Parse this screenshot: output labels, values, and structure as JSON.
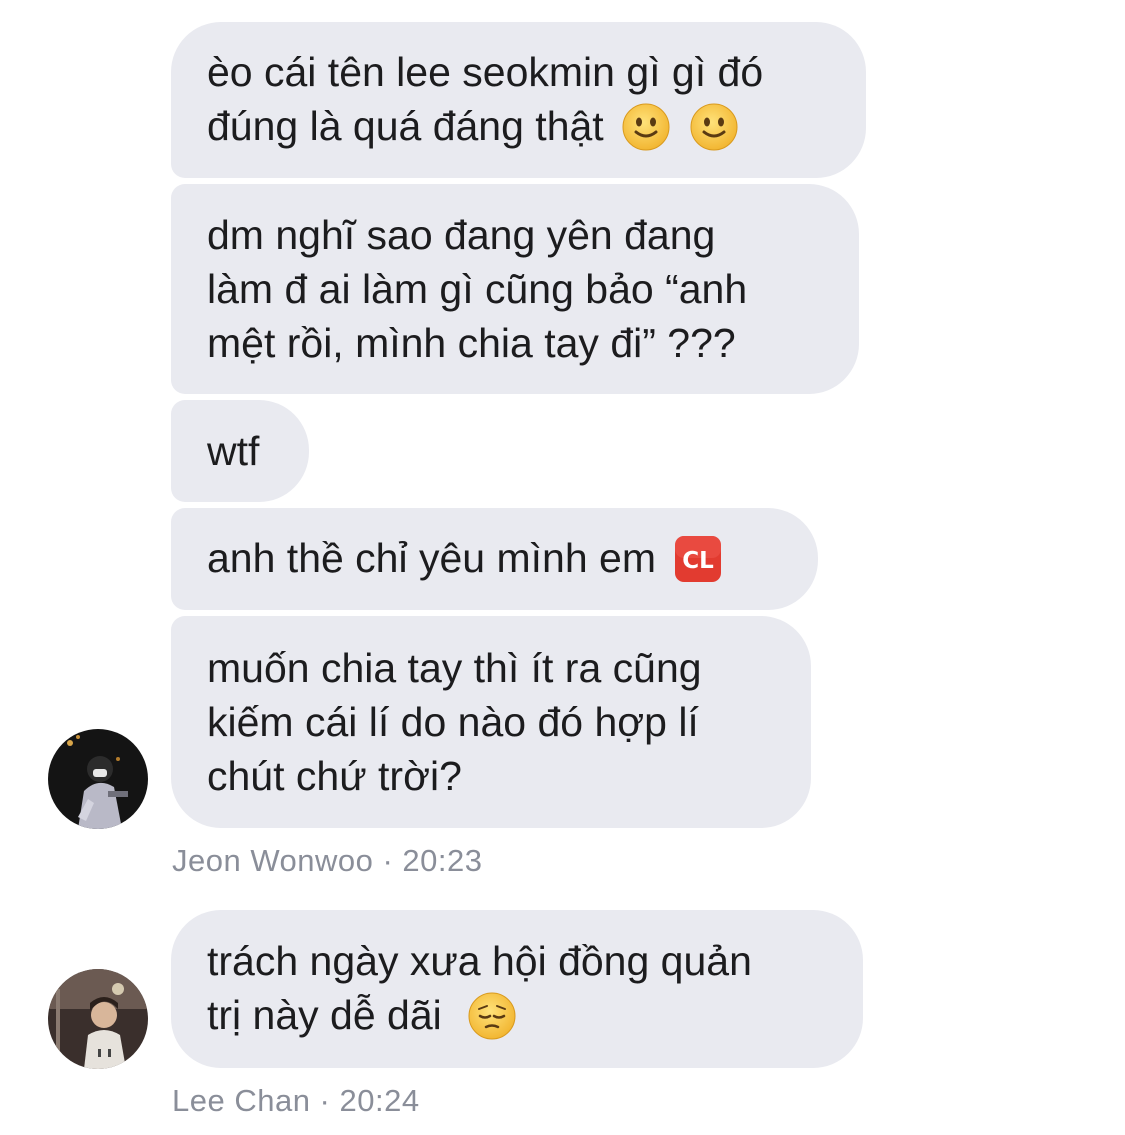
{
  "messages": [
    {
      "lines": [
        "èo cái tên lee seokmin gì gì đó",
        "đúng là quá đáng thật"
      ],
      "emoji": [
        "slightly-smiling-face",
        "slightly-smiling-face"
      ]
    },
    {
      "lines": [
        "dm nghĩ sao đang yên đang",
        "làm đ ai làm gì cũng bảo “anh",
        "mệt rồi, mình chia tay đi” ???"
      ]
    },
    {
      "lines": [
        "wtf"
      ]
    },
    {
      "lines": [
        "anh thề chỉ yêu mình em"
      ],
      "emoji": [
        "cl-button"
      ]
    },
    {
      "lines": [
        "muốn chia tay thì ít ra cũng",
        "kiếm cái lí do nào đó hợp lí",
        "chút chứ trời?"
      ]
    },
    {
      "lines": [
        "trách ngày xưa hội đồng quản",
        "trị này dễ dãi"
      ],
      "emoji": [
        "pensive-face"
      ]
    }
  ],
  "groups": [
    {
      "sender": "Jeon Wonwoo",
      "time": "20:23",
      "meta": "Jeon Wonwoo · 20:23",
      "avatar": "avatar-jeon-wonwoo"
    },
    {
      "sender": "Lee Chan",
      "time": "20:24",
      "meta": "Lee Chan · 20:24",
      "avatar": "avatar-lee-chan"
    }
  ],
  "colors": {
    "bubble": "#e9eaf0",
    "text": "#1c1c1e",
    "meta": "#8a8e99",
    "emoji_yellow": "#f7c84a",
    "cl_red": "#e23b30"
  }
}
